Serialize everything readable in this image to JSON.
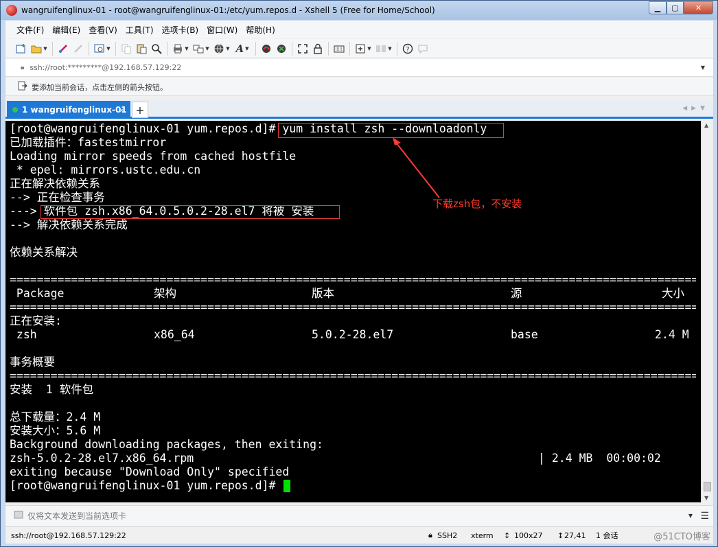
{
  "window": {
    "title": "wangruifenglinux-01 - root@wangruifenglinux-01:/etc/yum.repos.d - Xshell 5 (Free for Home/School)"
  },
  "menu": [
    {
      "label": "文件(F)"
    },
    {
      "label": "编辑(E)"
    },
    {
      "label": "查看(V)"
    },
    {
      "label": "工具(T)"
    },
    {
      "label": "选项卡(B)"
    },
    {
      "label": "窗口(W)"
    },
    {
      "label": "帮助(H)"
    }
  ],
  "address": {
    "value": "ssh://root:*********@192.168.57.129:22"
  },
  "hint": {
    "text": "要添加当前会话，点击左侧的箭头按钮。"
  },
  "tab": {
    "label": "1 wangruifenglinux-01",
    "close": "×",
    "add": "+"
  },
  "terminal": {
    "lines": [
      "[root@wangruifenglinux-01 yum.repos.d]# yum install zsh --downloadonly",
      "已加载插件：fastestmirror",
      "Loading mirror speeds from cached hostfile",
      " * epel: mirrors.ustc.edu.cn",
      "正在解决依赖关系",
      "--> 正在检查事务",
      "---> 软件包 zsh.x86_64.0.5.0.2-28.el7 将被 安装",
      "--> 解决依赖关系完成",
      "",
      "依赖关系解决",
      "",
      "",
      "",
      "",
      "正在安装:",
      "",
      "",
      "事务概要",
      "",
      "安装  1 软件包",
      "",
      "总下载量：2.4 M",
      "安装大小：5.6 M",
      "Background downloading packages, then exiting:",
      "zsh-5.0.2-28.el7.x86_64.rpm",
      "exiting because \"Download Only\" specified",
      "[root@wangruifenglinux-01 yum.repos.d]# "
    ],
    "rule": "==================================================================================================================================",
    "table_header": {
      "package": " Package",
      "arch": "架构",
      "version": "版本",
      "repo": "源",
      "size": "大小"
    },
    "table_row": {
      "package": " zsh",
      "arch": "x86_64",
      "version": "5.0.2-28.el7",
      "repo": "base",
      "size": "2.4 M"
    },
    "download_progress": "| 2.4 MB  00:00:02",
    "annotation": "下载zsh包，不安装"
  },
  "send_bar": {
    "placeholder": "仅将文本发送到当前选项卡"
  },
  "status": {
    "connection": "ssh://root@192.168.57.129:22",
    "protocol": "SSH2",
    "term": "xterm",
    "size": "100x27",
    "cursor": "27,41",
    "sessions": "1 会话",
    "watermark": "@51CTO博客"
  },
  "colors": {
    "terminal_bg": "#000000",
    "terminal_fg": "#ffffff",
    "highlight": "#e53935",
    "cursor": "#00e000",
    "tab_active": "#1e78d6"
  }
}
